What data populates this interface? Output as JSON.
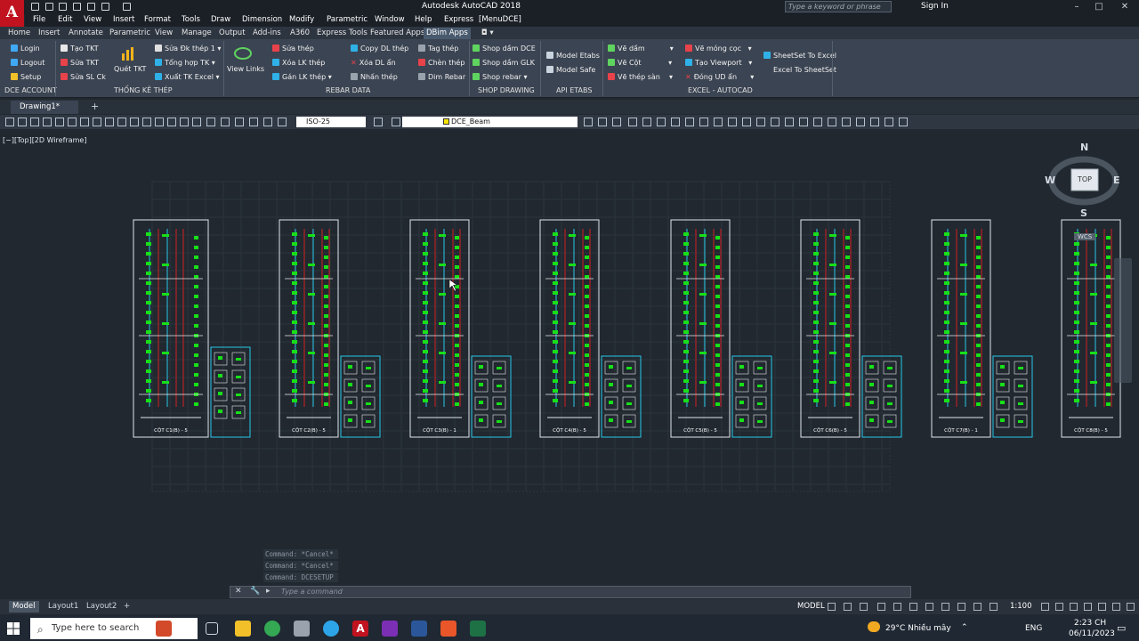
{
  "app": {
    "title": "Autodesk AutoCAD 2018",
    "logo_letter": "A",
    "search_placeholder": "Type a keyword or phrase",
    "signin": "Sign In"
  },
  "menu": [
    "File",
    "Edit",
    "View",
    "Insert",
    "Format",
    "Tools",
    "Draw",
    "Dimension",
    "Modify",
    "Parametric",
    "Window",
    "Help",
    "Express",
    "[MenuDCE]"
  ],
  "ribbon_tabs": [
    "Home",
    "Insert",
    "Annotate",
    "Parametric",
    "View",
    "Manage",
    "Output",
    "Add-ins",
    "A360",
    "Express Tools",
    "Featured Apps",
    "DBim Apps"
  ],
  "ribbon_active_tab": "DBim Apps",
  "ribbon": {
    "dce_account": [
      "Login",
      "Logout",
      "Setup"
    ],
    "tkt": [
      "Tạo TKT",
      "Sửa TKT",
      "Sửa SL Ck",
      "Quét TKT"
    ],
    "thong_ke": [
      "Sửa Đk thép 1",
      "Tổng hợp TK",
      "Xuất TK Excel",
      "View Links"
    ],
    "rebar_a": [
      "Sửa thép",
      "Xóa LK thép",
      "Gán LK thép"
    ],
    "rebar_b": [
      "Copy DL thép",
      "Xóa DL ẩn",
      "Nhấn thép"
    ],
    "rebar_c": [
      "Tag thép",
      "Chèn thép",
      "Dim Rebar"
    ],
    "shop": [
      "Shop dầm DCE",
      "Shop dầm GLK",
      "Shop rebar"
    ],
    "etabs": [
      "Model Etabs",
      "Model Safe"
    ],
    "ve": [
      "Vẽ dầm",
      "Vẽ Cột",
      "Vẽ thép sàn"
    ],
    "vp": [
      "Vẽ móng cọc",
      "Tạo Viewport",
      "Đóng UD ẩn"
    ],
    "excel": [
      "SheetSet To Excel",
      "Excel To SheetSet"
    ],
    "panels": [
      "DCE ACCOUNT",
      "THỐNG KÊ THÉP",
      "REBAR DATA",
      "SHOP DRAWING",
      "API ETABS",
      "EXCEL - AUTOCAD"
    ]
  },
  "toolbar": {
    "dim_style": "ISO-25",
    "layer": "DCE_Beam"
  },
  "doc_tab": "Drawing1*",
  "viewport_label": "[−][Top][2D Wireframe]",
  "viewcube": {
    "n": "N",
    "w": "W",
    "e": "E",
    "s": "S",
    "top": "TOP",
    "wcs": "WCS"
  },
  "sheets": [
    {
      "caption": "CỘT C1(B) - 5"
    },
    {
      "caption": "CỘT C2(B) - 5"
    },
    {
      "caption": "CỘT C3(B) - 1"
    },
    {
      "caption": "CỘT C4(B) - 5"
    },
    {
      "caption": "CỘT C5(B) - 5"
    },
    {
      "caption": "CỘT C6(B) - 5"
    },
    {
      "caption": "CỘT C7(B) - 1"
    },
    {
      "caption": "CỘT C8(B) - 5"
    }
  ],
  "command_history": [
    "Command: *Cancel*",
    "Command: *Cancel*",
    "Command: DCESETUP"
  ],
  "command_placeholder": "Type a command",
  "layout_tabs": [
    "Model",
    "Layout1",
    "Layout2"
  ],
  "status": {
    "model": "MODEL",
    "scale": "1:100"
  },
  "taskbar": {
    "search": "Type here to search",
    "weather": "29°C  Nhiều mây",
    "lang": "ENG",
    "time": "2:23 CH",
    "date": "06/11/2023"
  },
  "colors": {
    "accent_red": "#c1121f",
    "rebar_green": "#18e018",
    "rebar_red": "#d21f1f",
    "rebar_cyan": "#27c8e8",
    "active_tab": "#4a5a6e"
  }
}
